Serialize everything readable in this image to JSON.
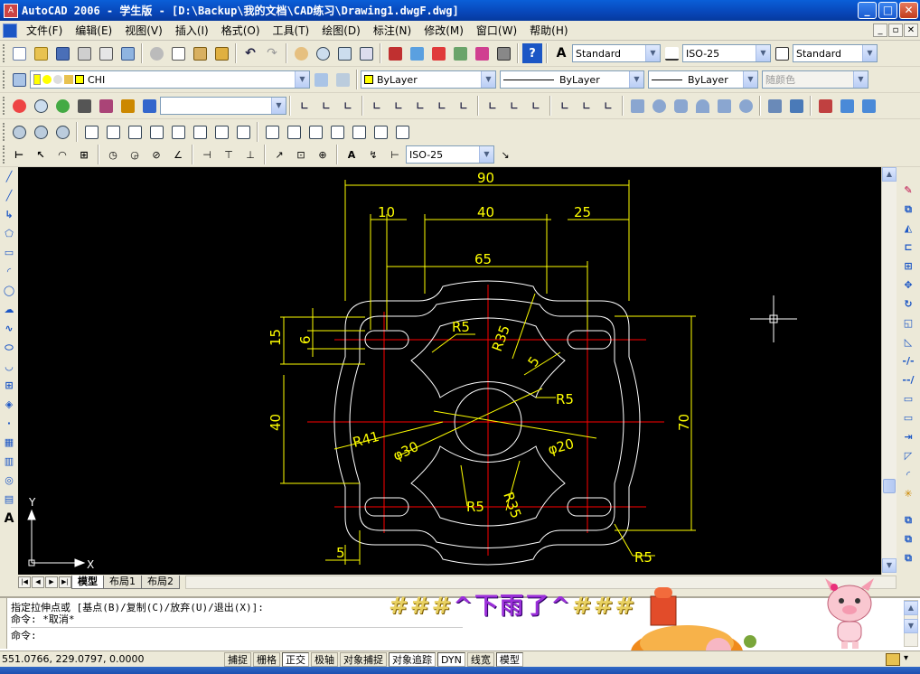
{
  "window": {
    "title": "AutoCAD 2006 - 学生版 - [D:\\Backup\\我的文档\\CAD练习\\Drawing1.dwgF.dwg]",
    "app_icon_label": "A"
  },
  "menu": [
    "文件(F)",
    "编辑(E)",
    "视图(V)",
    "插入(I)",
    "格式(O)",
    "工具(T)",
    "绘图(D)",
    "标注(N)",
    "修改(M)",
    "窗口(W)",
    "帮助(H)"
  ],
  "styles_toolbar": {
    "text_style": "Standard",
    "dim_style": "ISO-25",
    "table_style": "Standard"
  },
  "layers_toolbar": {
    "layer_name": "CHI"
  },
  "properties_toolbar": {
    "color": "ByLayer",
    "linetype": "ByLayer",
    "lineweight": "ByLayer",
    "plotstyle": "随颜色"
  },
  "dim_toolbar": {
    "dim_style": "ISO-25"
  },
  "drawing": {
    "dims": {
      "d90": "90",
      "d10": "10",
      "d40h": "40",
      "d25": "25",
      "d65": "65",
      "d15": "15",
      "d6": "6",
      "d40v": "40",
      "d70": "70",
      "d5": "5",
      "r5a": "R5",
      "r35a": "R35",
      "r5b": "R5",
      "r41": "R41",
      "phi30": "φ30",
      "phi20": "φ20",
      "r5c": "R5",
      "r35b": "R35",
      "r5d": "R5",
      "r5e": "R5"
    },
    "ucs": {
      "x": "X",
      "y": "Y"
    }
  },
  "tabs": [
    "模型",
    "布局1",
    "布局2"
  ],
  "active_tab": "模型",
  "command": {
    "line1": "指定拉伸点或 [基点(B)/复制(C)/放弃(U)/退出(X)]:",
    "line2": "命令: *取消*",
    "prompt": "命令:"
  },
  "banner": {
    "left": "###",
    "center": "^下雨了^",
    "right": "###"
  },
  "status": {
    "coords": "551.0766, 229.0797, 0.0000",
    "buttons": [
      "捕捉",
      "栅格",
      "正交",
      "极轴",
      "对象捕捉",
      "对象追踪",
      "DYN",
      "线宽",
      "模型"
    ]
  },
  "colors": {
    "canvas": "#000000",
    "drawing": "#ffffff",
    "dimension": "#ffff00",
    "centerline": "#ff0000",
    "titlebar": "#0a5fd8"
  }
}
